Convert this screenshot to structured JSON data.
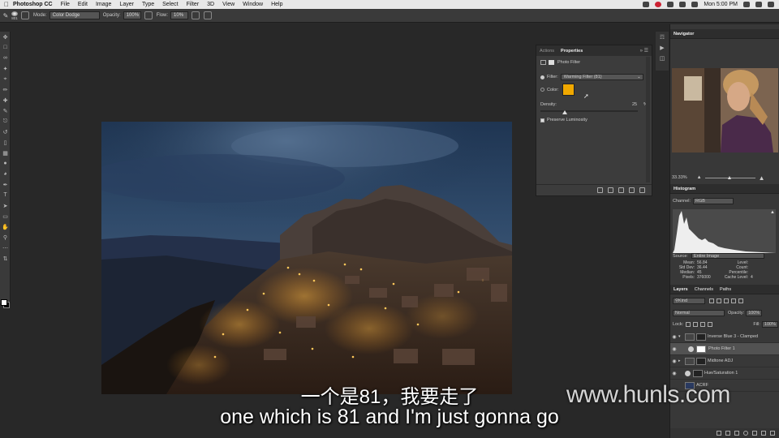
{
  "menubar": {
    "app": "Photoshop CC",
    "items": [
      "File",
      "Edit",
      "Image",
      "Layer",
      "Type",
      "Select",
      "Filter",
      "3D",
      "View",
      "Window",
      "Help"
    ],
    "clock": "Mon 5:00 PM"
  },
  "options": {
    "brush_size": "801",
    "mode_label": "Mode:",
    "mode_value": "Color Dodge",
    "opacity_label": "Opacity:",
    "opacity_value": "100%",
    "flow_label": "Flow:",
    "flow_value": "10%"
  },
  "properties": {
    "tab_actions": "Actions",
    "tab_properties": "Properties",
    "title": "Photo Filter",
    "filter_label": "Filter:",
    "filter_value": "Warming Filter (81)",
    "color_label": "Color:",
    "color_swatch": "#f0a800",
    "density_label": "Density:",
    "density_value": "25",
    "density_unit": "%",
    "density_level": 0.25,
    "preserve_label": "Preserve Luminosity"
  },
  "navigator": {
    "title": "Navigator",
    "zoom": "33.33%"
  },
  "histogram": {
    "title": "Histogram",
    "channel_label": "Channel:",
    "channel_value": "RGB",
    "source_label": "Source:",
    "source_value": "Entire Image",
    "stats": [
      {
        "label": "Mean:",
        "value": "56.84"
      },
      {
        "label": "Std Dev:",
        "value": "36.44"
      },
      {
        "label": "Median:",
        "value": "45"
      },
      {
        "label": "Pixels:",
        "value": "376000"
      }
    ],
    "stats_right": [
      {
        "label": "Level:",
        "value": ""
      },
      {
        "label": "Count:",
        "value": ""
      },
      {
        "label": "Percentile:",
        "value": ""
      },
      {
        "label": "Cache Level:",
        "value": "4"
      }
    ]
  },
  "layers": {
    "tabs": [
      "Layers",
      "Channels",
      "Paths"
    ],
    "kind_label": "Kind",
    "blend": "Normal",
    "opacity_label": "Opacity:",
    "opacity_value": "100%",
    "lock_label": "Lock:",
    "fill_label": "Fill:",
    "fill_value": "100%",
    "rows": [
      {
        "name": "Inverse Blue 3 - Clamped"
      },
      {
        "name": "Photo Filter 1"
      },
      {
        "name": "Midtone ADJ"
      },
      {
        "name": "Hue/Saturation 1"
      },
      {
        "name": "ACRF"
      }
    ]
  },
  "subtitles": {
    "cn": "一个是81，我要走了",
    "en": "one which is 81 and I'm just gonna go"
  },
  "watermark": "www.hunls.com"
}
